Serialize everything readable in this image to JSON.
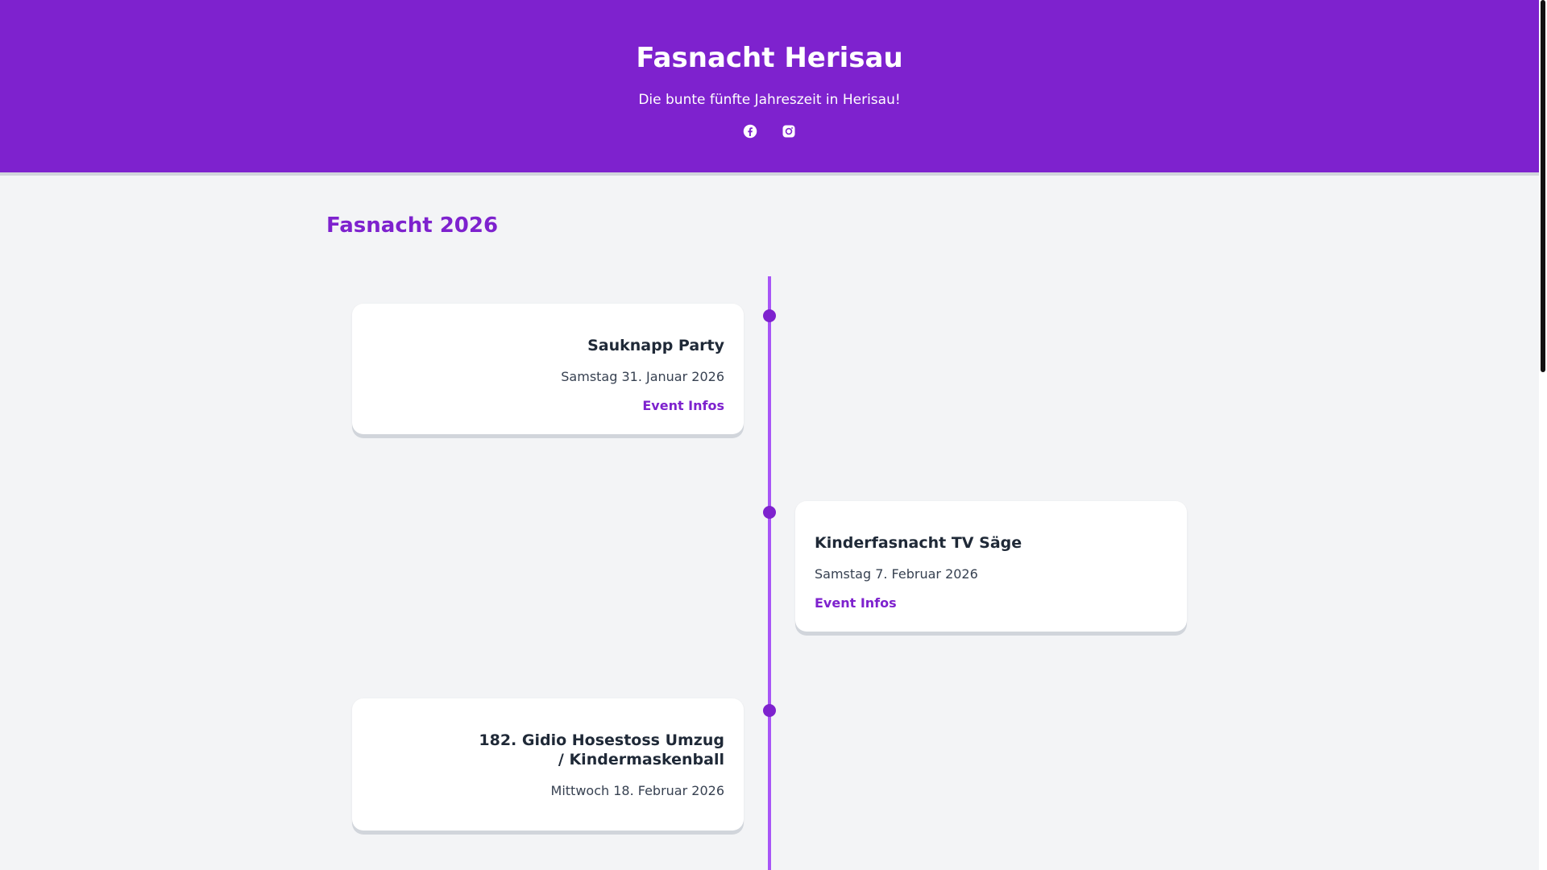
{
  "header": {
    "title": "Fasnacht Herisau",
    "subtitle": "Die bunte fünfte Jahreszeit in Herisau!",
    "social": [
      {
        "icon": "facebook-icon"
      },
      {
        "icon": "instagram-icon"
      }
    ]
  },
  "colors": {
    "brand": "#7e22ce",
    "timeline": "#a855f7",
    "background": "#f3f4f6",
    "card": "#ffffff"
  },
  "section": {
    "title": "Fasnacht 2026"
  },
  "events": [
    {
      "title": "Sauknapp Party",
      "date": "Samstag 31. Januar 2026",
      "link": "Event Infos"
    },
    {
      "title": "Kinderfasnacht TV Säge",
      "date": "Samstag 7. Februar 2026",
      "link": "Event Infos"
    },
    {
      "title": "182. Gidio Hosestoss Umzug / Kindermaskenball",
      "date": "Mittwoch 18. Februar 2026"
    }
  ]
}
